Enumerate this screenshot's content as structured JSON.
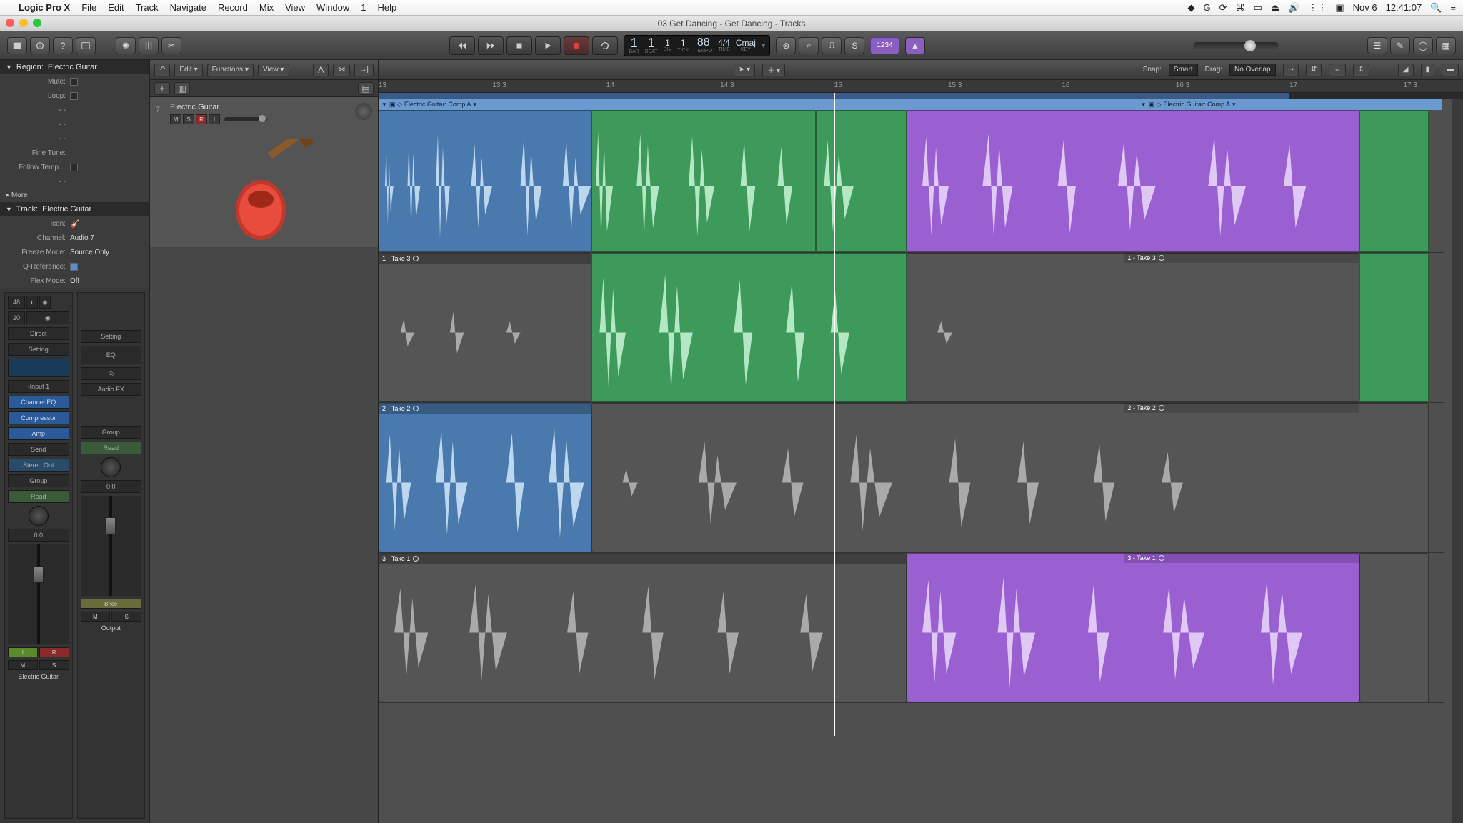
{
  "menubar": {
    "app": "Logic Pro X",
    "items": [
      "File",
      "Edit",
      "Track",
      "Navigate",
      "Record",
      "Mix",
      "View",
      "Window",
      "1",
      "Help"
    ],
    "date": "Nov 6",
    "time": "12:41:07"
  },
  "window": {
    "title": "03 Get Dancing - Get Dancing - Tracks"
  },
  "lcd": {
    "bar": "1",
    "beat": "1",
    "div": "1",
    "tick": "1",
    "tempo": "88",
    "sig": "4/4",
    "key": "Cmaj",
    "bar_lbl": "BAR",
    "beat_lbl": "BEAT",
    "div_lbl": "DIV",
    "tick_lbl": "TICK",
    "tempo_lbl": "TEMPO",
    "time_lbl": "TIME",
    "key_lbl": "KEY"
  },
  "mode_1234": "1234",
  "inspector": {
    "region_label": "Region:",
    "region_name": "Electric Guitar",
    "mute": "Mute:",
    "loop": "Loop:",
    "finetune": "Fine Tune:",
    "follow": "Follow Temp…",
    "more": "More",
    "track_label": "Track:",
    "track_name": "Electric Guitar",
    "icon": "Icon:",
    "channel": "Channel:",
    "channel_val": "Audio 7",
    "freeze": "Freeze Mode:",
    "freeze_val": "Source Only",
    "qref": "Q-Reference:",
    "flex": "Flex Mode:",
    "flex_val": "Off",
    "num48": "48",
    "num20": "20",
    "direct": "Direct",
    "setting": "Setting",
    "input": "Input 1",
    "eq": "EQ",
    "ch_eq": "Channel EQ",
    "compressor": "Compressor",
    "amp": "Amp",
    "audiofx": "Audio FX",
    "send": "Send",
    "stereoout": "Stereo Out",
    "group": "Group",
    "read": "Read",
    "db": "0.0",
    "i": "I",
    "r": "R",
    "m": "M",
    "s": "S",
    "bnce": "Bnce",
    "ch1_name": "Electric Guitar",
    "ch2_name": "Output"
  },
  "track": {
    "edit": "Edit",
    "functions": "Functions",
    "view": "View",
    "name": "Electric Guitar",
    "m": "M",
    "s": "S",
    "r": "R",
    "i": "I",
    "num": "7"
  },
  "arrange": {
    "snap_lbl": "Snap:",
    "snap_val": "Smart",
    "drag_lbl": "Drag:",
    "drag_val": "No Overlap",
    "ruler": [
      "13",
      "13 3",
      "14",
      "14 3",
      "15",
      "15 3",
      "16",
      "16 3",
      "17",
      "17 3"
    ],
    "comp_a": "Electric Guitar: Comp A",
    "take3": "1 - Take 3",
    "take2": "2 - Take 2",
    "take1": "3 - Take 1"
  }
}
